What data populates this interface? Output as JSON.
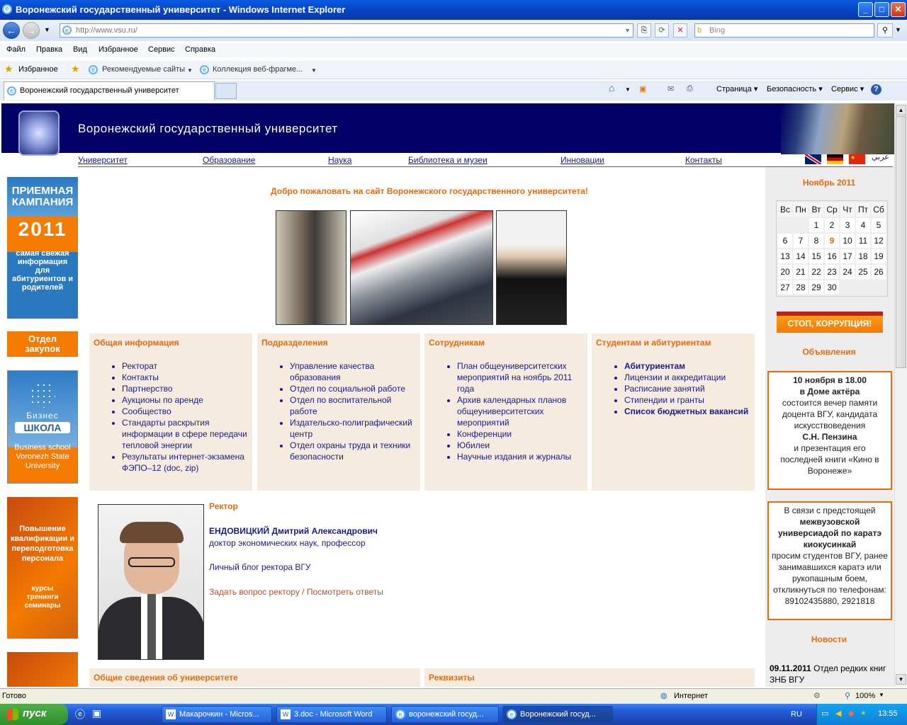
{
  "window": {
    "title": "Воронежский государственный университет - Windows Internet Explorer"
  },
  "address": {
    "url": "http://www.vsu.ru/",
    "search_placeholder": "Bing"
  },
  "menu": [
    "Файл",
    "Правка",
    "Вид",
    "Избранное",
    "Сервис",
    "Справка"
  ],
  "favorites": {
    "label": "Избранное",
    "suggested": "Рекомендуемые сайты",
    "gallery": "Коллекция веб-фрагме..."
  },
  "tab": {
    "title": "Воронежский государственный университет"
  },
  "toolbar": {
    "page": "Страница",
    "safety": "Безопасность",
    "service": "Сервис"
  },
  "site": {
    "title": "Воронежский государственный университет",
    "nav": [
      "Университет",
      "Образование",
      "Наука",
      "Библиотека и музеи",
      "Инновации",
      "Контакты"
    ],
    "arabic": "عربي",
    "welcome": "Добро пожаловать на сайт Воронежского государственного университета!"
  },
  "banners": {
    "admission": {
      "line1": "ПРИЕМНАЯ",
      "line2": "КАМПАНИЯ",
      "year": "2011",
      "text": "самая свежая информация для абитуриентов и родителей"
    },
    "procurement": "Отдел закупок",
    "business": {
      "line1": "Бизнес",
      "line2": "ШКОЛА",
      "text": "Business school Voronezh State University"
    },
    "qualification": {
      "text": "Повышение квалификации и переподготовка персонала",
      "sub": "курсы тренинги семинары"
    }
  },
  "boxes": [
    {
      "title": "Общая информация",
      "items": [
        "Ректорат",
        "Контакты",
        "Партнерство",
        "Аукционы по аренде",
        "Сообщество",
        "Стандарты раскрытия информации в сфере передачи тепловой энергии",
        "Результаты интернет-экзамена ФЭПО–12 (doc, zip)"
      ]
    },
    {
      "title": "Подразделения",
      "items": [
        "Управление качества образования",
        "Отдел по социальной работе",
        "Отдел по воспитательной работе",
        "Издательско-полиграфический центр",
        "Отдел охраны труда и техники безопасности"
      ]
    },
    {
      "title": "Сотрудникам",
      "items": [
        "План общеуниверситетских мероприятий на ноябрь 2011 года",
        "Архив календарных планов общеуниверситетских мероприятий",
        "Конференции",
        "Юбилеи",
        "Научные издания и журналы"
      ]
    },
    {
      "title": "Студентам и абитуриентам",
      "items": [
        "Абитуриентам",
        "Лицензии и аккредитации",
        "Расписание занятий",
        "Стипендии и гранты",
        "Список бюджетных вакансий"
      ]
    }
  ],
  "rector": {
    "heading": "Ректор",
    "name": "ЕНДОВИЦКИЙ Дмитрий Александрович",
    "degree": "доктор экономических наук, профессор",
    "blog": "Личный блог ректора ВГУ",
    "ask": "Задать вопрос ректору",
    "sep": " / ",
    "answers": "Посмотреть ответы"
  },
  "bottom": {
    "general": "Общие сведения об университете",
    "requisites": "Реквизиты"
  },
  "calendar": {
    "title": "Ноябрь 2011",
    "days": [
      "Вс",
      "Пн",
      "Вт",
      "Ср",
      "Чт",
      "Пт",
      "Сб"
    ],
    "weeks": [
      [
        "",
        "",
        "1",
        "2",
        "3",
        "4",
        "5"
      ],
      [
        "6",
        "7",
        "8",
        "9",
        "10",
        "11",
        "12"
      ],
      [
        "13",
        "14",
        "15",
        "16",
        "17",
        "18",
        "19"
      ],
      [
        "20",
        "21",
        "22",
        "23",
        "24",
        "25",
        "26"
      ],
      [
        "27",
        "28",
        "29",
        "30",
        "",
        "",
        ""
      ]
    ],
    "today": "9"
  },
  "corruption": "СТОП, КОРРУПЦИЯ!",
  "announcements": {
    "title": "Объявления",
    "a1": {
      "l1": "10 ноября в 18.00",
      "l2": "в Доме актёра",
      "l3": "состоится вечер памяти доцента ВГУ, кандидата искусствоведения",
      "l4": "С.Н. Пензина",
      "l5": "и презентация его последней книги «Кино в Воронеже»"
    },
    "a2": {
      "l1": "В связи с предстоящей",
      "l2": "межвузовской универсиадой по каратэ киокусинкай",
      "l3": "просим студентов ВГУ, ранее занимавшихся каратэ или рукопашным боем, откликнуться по телефонам:",
      "l4": "89102435880, 2921818"
    }
  },
  "news": {
    "title": "Новости",
    "date": "09.11.2011",
    "text": "Отдел редких книг ЗНБ ВГУ"
  },
  "status": {
    "text": "Готово",
    "zone": "Интернет",
    "zoom": "100%"
  },
  "taskbar": {
    "start": "пуск",
    "tasks": [
      "Макарочкин - Micros...",
      "3.doc - Microsoft Word",
      "воронежский госуд...",
      "Воронежский госуд..."
    ],
    "lang": "RU",
    "time": "13:55"
  }
}
